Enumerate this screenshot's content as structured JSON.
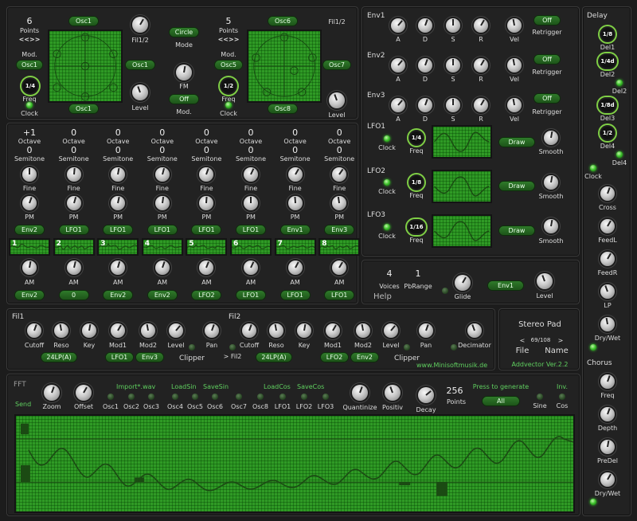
{
  "osc_left": {
    "points": "6",
    "points_label": "Points",
    "nav": "<<>>",
    "mod_label": "Mod.",
    "mod_btn": "Osc1",
    "freq_value": "1/4",
    "freq_label": "Freq",
    "clock_label": "Clock",
    "top_btn": "Osc1",
    "bottom_btn": "Osc1",
    "side_btn": "Osc1",
    "fil_label": "Fil1/2",
    "level_label": "Level"
  },
  "osc_mid": {
    "mode_btn": "Circle",
    "mode_label": "Mode",
    "fm_label": "FM",
    "mod_btn": "Off",
    "mod_label": "Mod."
  },
  "osc_right": {
    "points": "5",
    "points_label": "Points",
    "nav": "<<>>",
    "mod_label": "Mod.",
    "mod_btn": "Osc5",
    "freq_value": "1/2",
    "freq_label": "Freq",
    "clock_label": "Clock",
    "top_btn": "Osc6",
    "bottom_btn": "Osc8",
    "side_btn": "Osc7",
    "fil_label": "Fil1/2",
    "level_label": "Level"
  },
  "env": {
    "rows": [
      {
        "name": "Env1",
        "retrigger": "Off"
      },
      {
        "name": "Env2",
        "retrigger": "Off"
      },
      {
        "name": "Env3",
        "retrigger": "Off"
      }
    ],
    "knob_labels": [
      "A",
      "D",
      "S",
      "R",
      "Vel"
    ],
    "retrigger_label": "Retrigger"
  },
  "lfo": {
    "rows": [
      {
        "name": "LFO1",
        "freq": "1/4"
      },
      {
        "name": "LFO2",
        "freq": "1/8"
      },
      {
        "name": "LFO3",
        "freq": "1/16"
      }
    ],
    "clock_label": "Clock",
    "freq_label": "Freq",
    "draw_btn": "Draw",
    "smooth_label": "Smooth"
  },
  "delay": {
    "title": "Delay",
    "del1": "1/8",
    "del1_label": "Del1",
    "del2": "1/4d",
    "del2_label": "Del2",
    "del2b": "Del2",
    "del3": "1/8d",
    "del3_label": "Del3",
    "del4": "1/2",
    "del4_label": "Del4",
    "del4b": "Del4",
    "clock_label": "Clock",
    "cross": "Cross",
    "feedl": "FeedL",
    "feedr": "FeedR",
    "lp": "LP",
    "drywet": "Dry/Wet"
  },
  "chorus": {
    "title": "Chorus",
    "freq": "Freq",
    "depth": "Depth",
    "predel": "PreDel",
    "drywet": "Dry/Wet"
  },
  "osc_columns": [
    {
      "octave": "+1",
      "semitone": "0",
      "num": "1",
      "mod1": "Env2",
      "mod2": "Env2"
    },
    {
      "octave": "0",
      "semitone": "0",
      "num": "2",
      "mod1": "LFO1",
      "mod2": "0"
    },
    {
      "octave": "0",
      "semitone": "0",
      "num": "3",
      "mod1": "LFO1",
      "mod2": "Env2"
    },
    {
      "octave": "0",
      "semitone": "0",
      "num": "4",
      "mod1": "LFO1",
      "mod2": "Env2"
    },
    {
      "octave": "0",
      "semitone": "0",
      "num": "5",
      "mod1": "LFO1",
      "mod2": "LFO2"
    },
    {
      "octave": "0",
      "semitone": "0",
      "num": "6",
      "mod1": "LFO1",
      "mod2": "LFO1"
    },
    {
      "octave": "0",
      "semitone": "0",
      "num": "7",
      "mod1": "Env1",
      "mod2": "LFO1"
    },
    {
      "octave": "0",
      "semitone": "0",
      "num": "8",
      "mod1": "Env3",
      "mod2": "LFO1"
    }
  ],
  "col_labels": {
    "octave": "Octave",
    "semitone": "Semitone",
    "fine": "Fine",
    "pm": "PM",
    "am": "AM"
  },
  "voices": {
    "voices": "4",
    "voices_label": "Voices",
    "pbrange": "1",
    "pbrange_label": "PbRange",
    "help": "Help",
    "glide": "Glide",
    "env_btn": "Env1",
    "level": "Level"
  },
  "filters": {
    "fil1": "Fil1",
    "fil2": "Fil2",
    "fil2_link": "> Fil2",
    "labels": [
      "Cutoff",
      "Reso",
      "Key",
      "Mod1",
      "Mod2",
      "Level",
      "Pan"
    ],
    "fil1_type": "24LP(A)",
    "fil1_mod1": "LFO1",
    "fil1_mod2": "Env3",
    "fil2_type": "24LP(A)",
    "fil2_mod1": "LFO2",
    "fil2_mod2": "Env2",
    "clipper": "Clipper",
    "clipper2": "Clipper",
    "decimator": "Decimator",
    "website": "www.Minisoftmusik.de"
  },
  "preset": {
    "name": "Stereo Pad",
    "prev": "<",
    "counter": "69/108",
    "next": ">",
    "file": "File",
    "name_label": "Name",
    "version": "Addvector Ver.2.2"
  },
  "fft": {
    "title": "FFT",
    "send": "Send",
    "zoom": "Zoom",
    "offset": "Offset",
    "import": "Import*.wav",
    "loadsin": "LoadSin",
    "savesin": "SaveSin",
    "loadcos": "LoadCos",
    "savecos": "SaveCos",
    "targets": [
      "Osc1",
      "Osc2",
      "Osc3",
      "Osc4",
      "Osc5",
      "Osc6",
      "Osc7",
      "Osc8",
      "LFO1",
      "LFO2",
      "LFO3"
    ],
    "quantize": "Quantinize",
    "positiv": "Positiv",
    "decay": "Decay",
    "points": "256",
    "points_label": "Points",
    "press": "Press to generate",
    "all_btn": "All",
    "inv": "Inv.",
    "sine": "Sine",
    "cos": "Cos"
  }
}
